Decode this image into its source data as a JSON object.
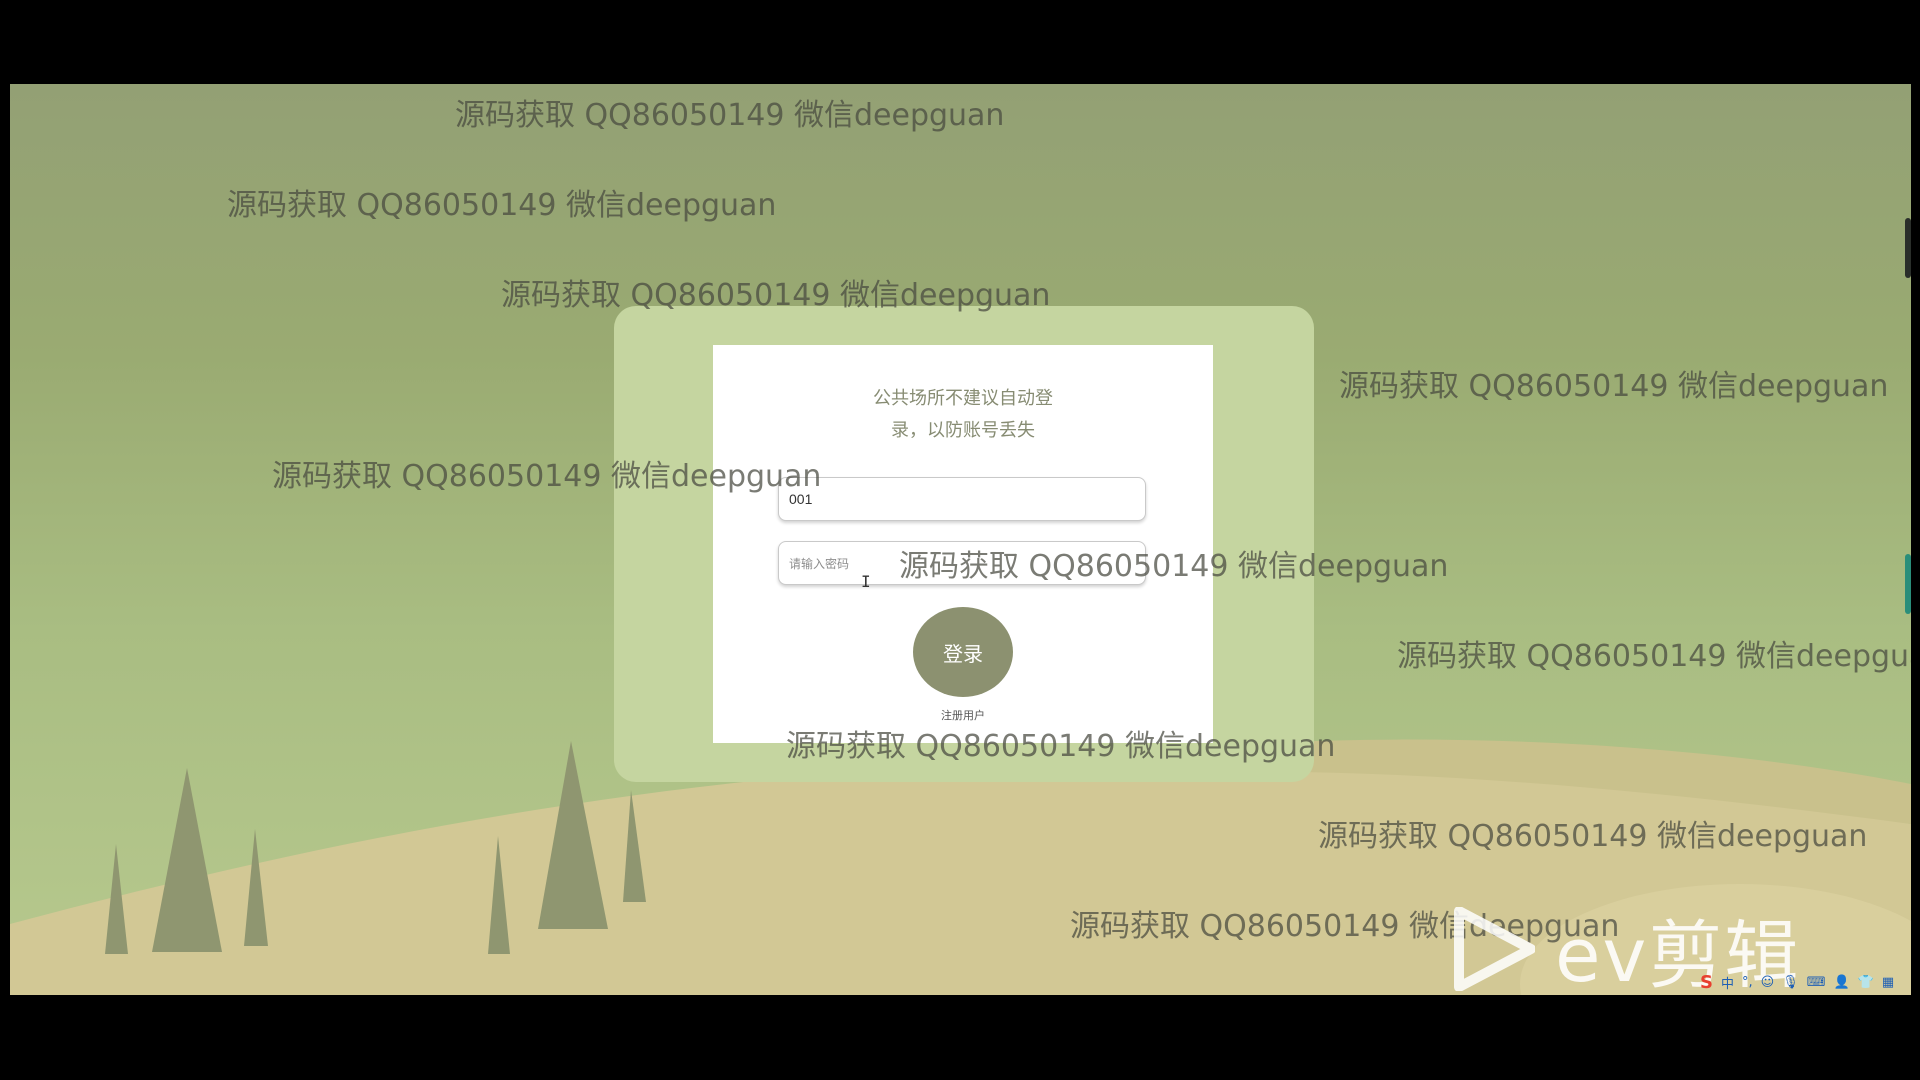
{
  "login": {
    "notice_line1": "公共场所不建议自动登",
    "notice_line2": "录，以防账号丢失",
    "username_value": "001",
    "password_placeholder": "请输入密码",
    "login_label": "登录",
    "register_label": "注册用户"
  },
  "watermark": {
    "text": "源码获取 QQ86050149 微信deepguan",
    "text_truncated": "源码获取 QQ86050149 微信deepgua"
  },
  "overlay": {
    "logo_text": "ev剪辑"
  },
  "tray": {
    "ime_label": "中",
    "icons": [
      "sogou-ime-icon",
      "punctuation-icon",
      "emoji-icon",
      "microphone-icon",
      "keyboard-icon",
      "user-icon",
      "shirt-icon",
      "grid-icon"
    ]
  },
  "colors": {
    "background_top": "#93a074",
    "panel": "#c5d5a0",
    "button": "#8c9170",
    "hill": "#d2c895",
    "tree": "#8f9670"
  }
}
